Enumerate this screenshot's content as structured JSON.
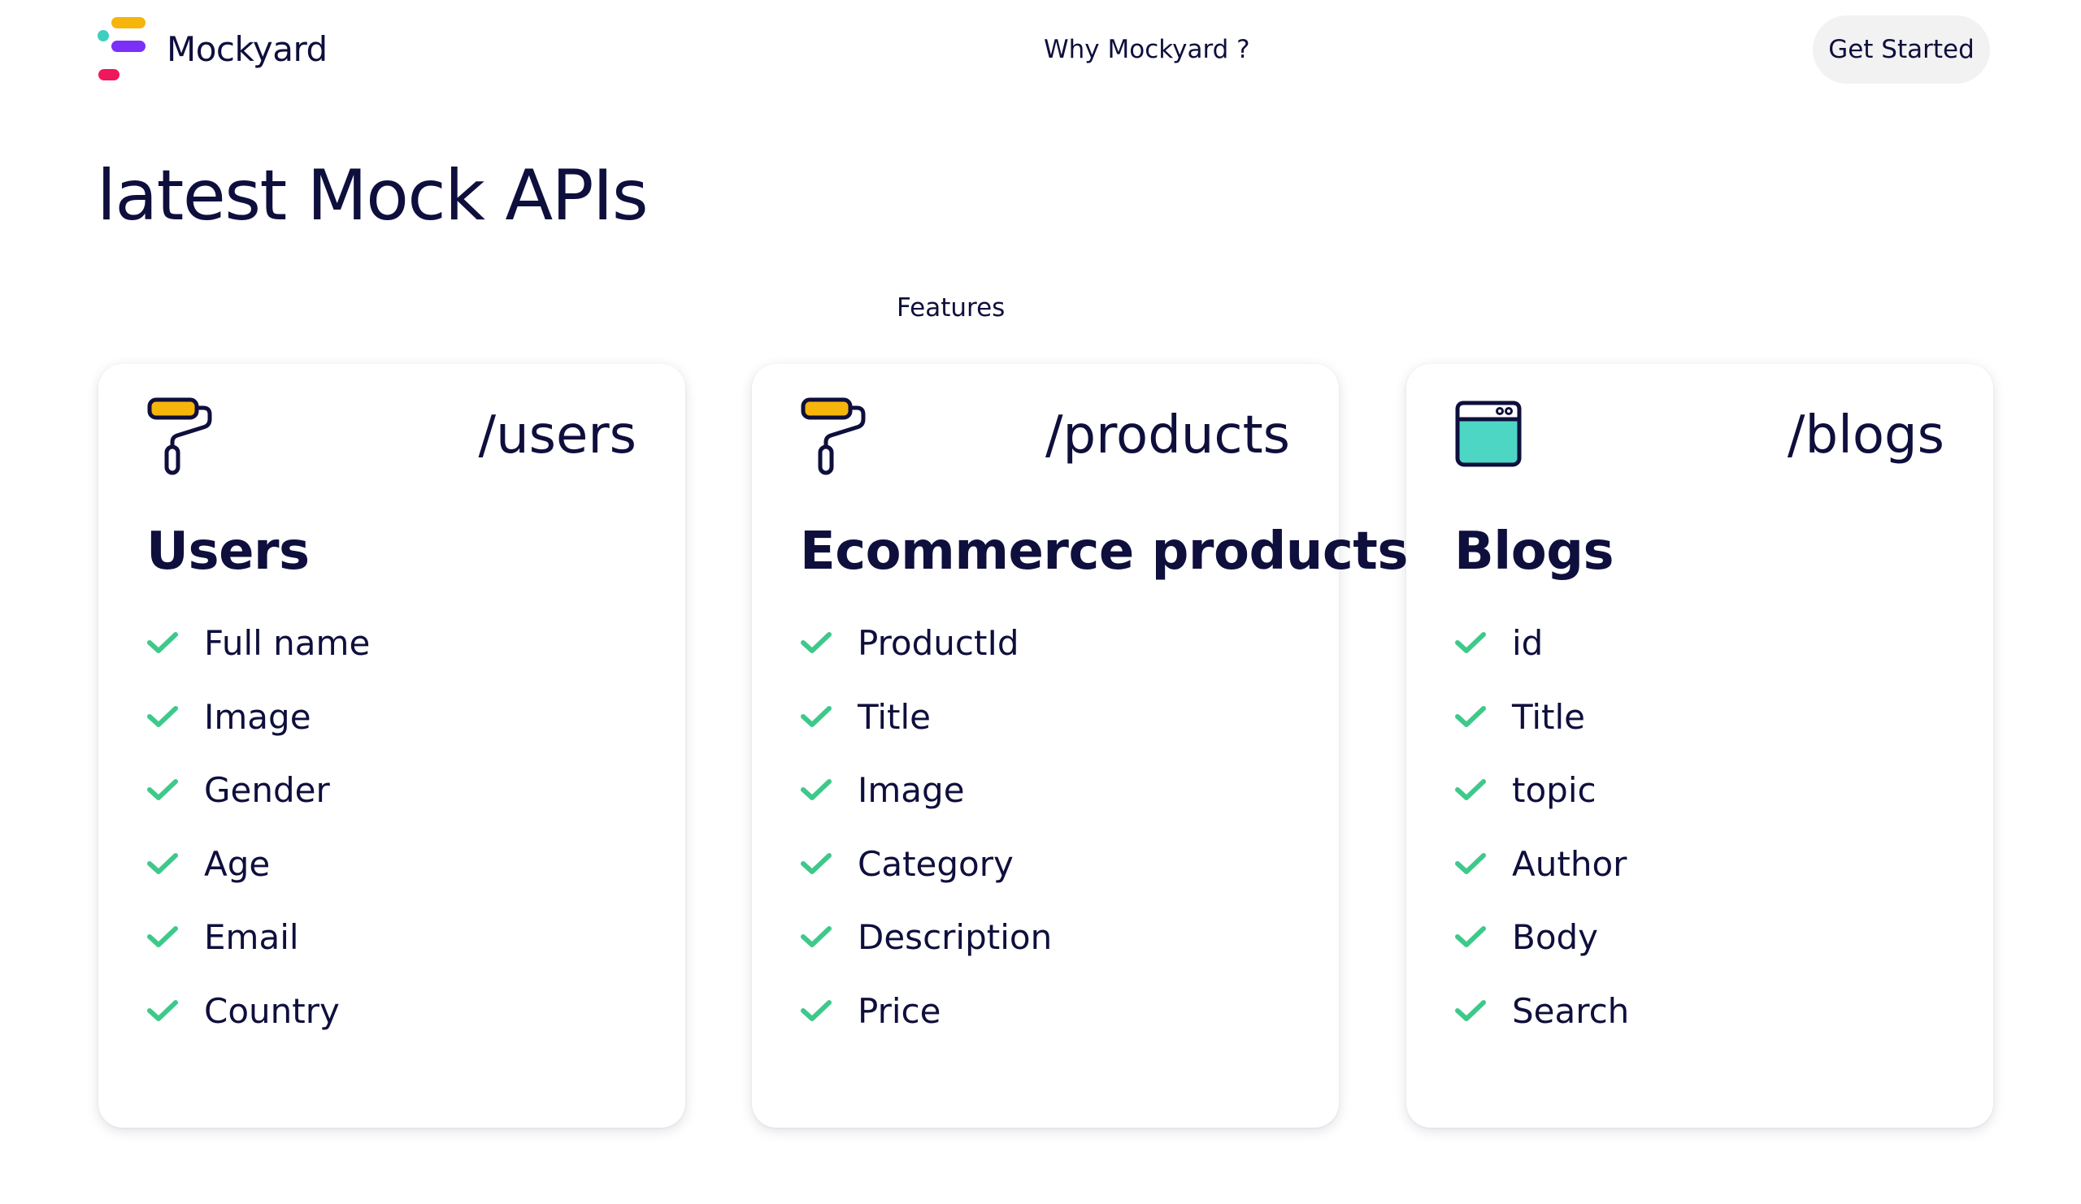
{
  "header": {
    "brand": "Mockyard",
    "nav": [
      {
        "label": "Features"
      },
      {
        "label": "Why Mockyard ?"
      }
    ],
    "cta_label": "Get Started",
    "logo_colors": [
      "#f5b50a",
      "#3ecfc0",
      "#7b2ff7",
      "#f0185c"
    ]
  },
  "main": {
    "title": "latest Mock APIs"
  },
  "cards": [
    {
      "icon": "paint-roller-icon",
      "path": "/users",
      "title": "Users",
      "features": [
        "Full name",
        "Image",
        "Gender",
        "Age",
        "Email",
        "Country"
      ]
    },
    {
      "icon": "paint-roller-icon",
      "path": "/products",
      "title": "Ecommerce products",
      "features": [
        "ProductId",
        "Title",
        "Image",
        "Category",
        "Description",
        "Price"
      ]
    },
    {
      "icon": "browser-window-icon",
      "path": "/blogs",
      "title": "Blogs",
      "features": [
        "id",
        "Title",
        "topic",
        "Author",
        "Body",
        "Search"
      ]
    }
  ],
  "colors": {
    "text": "#0f0f3d",
    "check": "#3ec98a",
    "roller": "#f5b50a",
    "window": "#4dd6c4",
    "cta_bg": "#f2f2f2"
  }
}
